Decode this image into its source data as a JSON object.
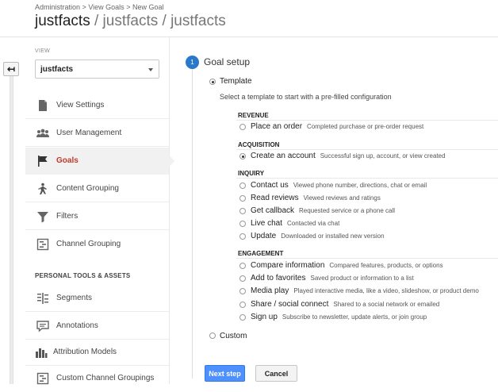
{
  "breadcrumb": [
    "Administration",
    "View Goals",
    "New Goal"
  ],
  "breadcrumb_sep": ">",
  "title": {
    "main": "justfacts",
    "sub": " / justfacts / justfacts"
  },
  "sidebar": {
    "view_label": "VIEW",
    "view_value": "justfacts",
    "items": [
      {
        "label": "View Settings",
        "icon": "document-icon"
      },
      {
        "label": "User Management",
        "icon": "users-icon"
      },
      {
        "label": "Goals",
        "icon": "flag-icon",
        "active": true
      },
      {
        "label": "Content Grouping",
        "icon": "person-walk-icon"
      },
      {
        "label": "Filters",
        "icon": "funnel-icon"
      },
      {
        "label": "Channel Grouping",
        "icon": "channel-icon"
      }
    ],
    "section_header": "PERSONAL TOOLS & ASSETS",
    "tools": [
      {
        "label": "Segments",
        "icon": "segments-icon"
      },
      {
        "label": "Annotations",
        "icon": "speech-bubble-icon"
      },
      {
        "label": "Attribution Models",
        "icon": "bar-chart-icon"
      },
      {
        "label": "Custom Channel Groupings",
        "icon": "channel-icon"
      }
    ]
  },
  "goal_setup": {
    "step_number": "1",
    "title": "Goal setup",
    "template_label": "Template",
    "template_help": "Select a template to start with a pre-filled configuration",
    "custom_label": "Custom",
    "categories": [
      {
        "name": "REVENUE",
        "options": [
          {
            "name": "Place an order",
            "desc": "Completed purchase or pre-order request",
            "checked": false
          }
        ]
      },
      {
        "name": "ACQUISITION",
        "options": [
          {
            "name": "Create an account",
            "desc": "Successful sign up, account, or view created",
            "checked": true
          }
        ]
      },
      {
        "name": "INQUIRY",
        "options": [
          {
            "name": "Contact us",
            "desc": "Viewed phone number, directions, chat or email",
            "checked": false
          },
          {
            "name": "Read reviews",
            "desc": "Viewed reviews and ratings",
            "checked": false
          },
          {
            "name": "Get callback",
            "desc": "Requested service or a phone call",
            "checked": false
          },
          {
            "name": "Live chat",
            "desc": "Contacted via chat",
            "checked": false
          },
          {
            "name": "Update",
            "desc": "Downloaded or installed new version",
            "checked": false
          }
        ]
      },
      {
        "name": "ENGAGEMENT",
        "options": [
          {
            "name": "Compare information",
            "desc": "Compared features, products, or options",
            "checked": false
          },
          {
            "name": "Add to favorites",
            "desc": "Saved product or information to a list",
            "checked": false
          },
          {
            "name": "Media play",
            "desc": "Played interactive media, like a video, slideshow, or product demo",
            "checked": false
          },
          {
            "name": "Share / social connect",
            "desc": "Shared to a social network or emailed",
            "checked": false
          },
          {
            "name": "Sign up",
            "desc": "Subscribe to newsletter, update alerts, or join group",
            "checked": false
          }
        ]
      }
    ],
    "next_label": "Next step",
    "cancel_label": "Cancel"
  },
  "colors": {
    "accent": "#2a78c9",
    "active_nav": "#c0392b",
    "primary_button": "#4d90fe"
  }
}
